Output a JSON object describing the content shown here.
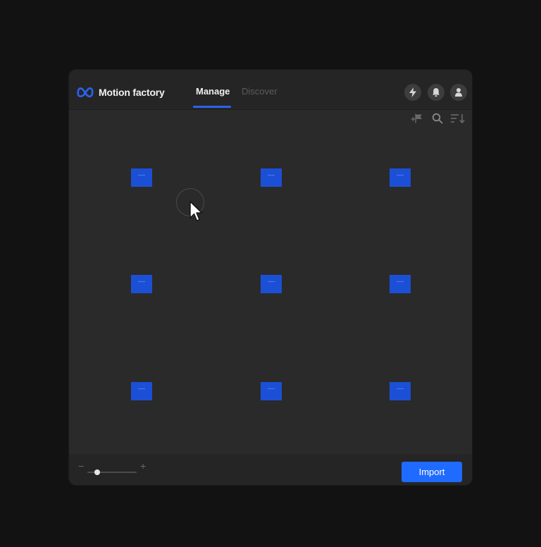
{
  "app": {
    "title": "Motion factory",
    "logo_icon": "meta-infinity-logo-icon",
    "brand_color": "#2b62ee"
  },
  "tabs": [
    {
      "label": "Manage",
      "active": true
    },
    {
      "label": "Discover",
      "active": false
    }
  ],
  "header_actions": [
    {
      "icon": "lightning-icon"
    },
    {
      "icon": "bell-icon"
    },
    {
      "icon": "user-icon"
    }
  ],
  "toolbar": [
    {
      "icon": "flag-add-icon"
    },
    {
      "icon": "search-icon"
    },
    {
      "icon": "sort-icon"
    }
  ],
  "grid": {
    "rows": 3,
    "columns": 3,
    "tile_color": "#1b50d6"
  },
  "footer": {
    "zoom_minus": "−",
    "zoom_plus": "+",
    "zoom_value": 0.2,
    "import_label": "Import",
    "accent_color": "#1f6bff"
  }
}
